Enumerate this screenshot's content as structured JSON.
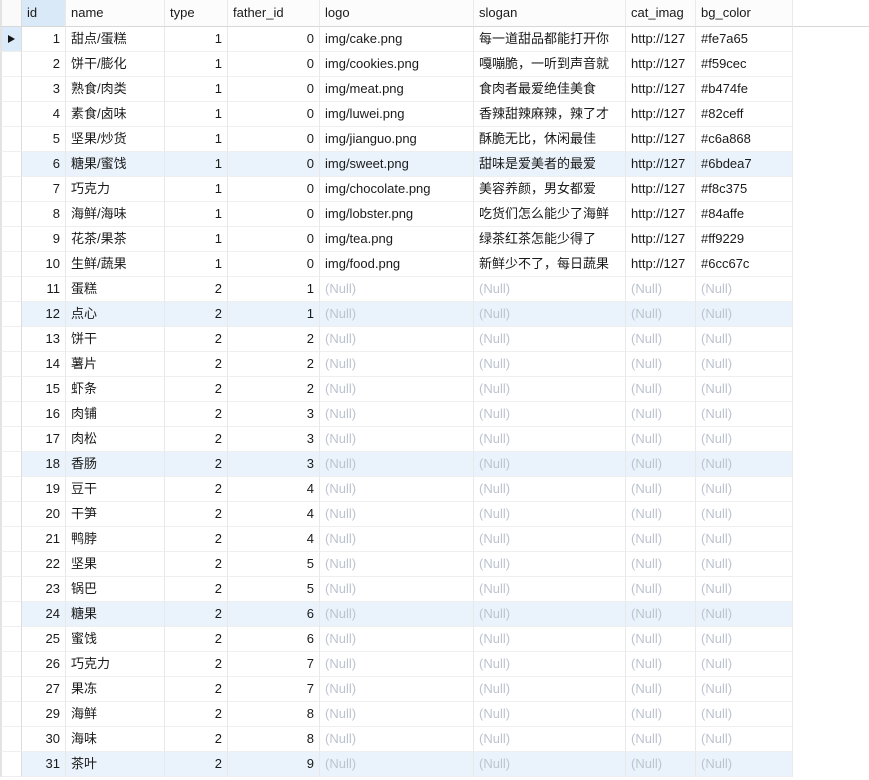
{
  "grid": {
    "columns": [
      {
        "key": "id",
        "label": "id"
      },
      {
        "key": "name",
        "label": "name"
      },
      {
        "key": "type",
        "label": "type"
      },
      {
        "key": "father_id",
        "label": "father_id"
      },
      {
        "key": "logo",
        "label": "logo"
      },
      {
        "key": "slogan",
        "label": "slogan"
      },
      {
        "key": "cat_imag",
        "label": "cat_imag"
      },
      {
        "key": "bg_color",
        "label": "bg_color"
      }
    ],
    "selected_column": "id",
    "current_row_id": "1",
    "null_text": "(Null)",
    "rows": [
      {
        "id": "1",
        "name": "甜点/蛋糕",
        "type": "1",
        "father_id": "0",
        "logo": "img/cake.png",
        "slogan": "每一道甜品都能打开你",
        "cat_imag": "http://127",
        "bg_color": "#fe7a65"
      },
      {
        "id": "2",
        "name": "饼干/膨化",
        "type": "1",
        "father_id": "0",
        "logo": "img/cookies.png",
        "slogan": "嘎嘣脆，一听到声音就",
        "cat_imag": "http://127",
        "bg_color": "#f59cec"
      },
      {
        "id": "3",
        "name": "熟食/肉类",
        "type": "1",
        "father_id": "0",
        "logo": "img/meat.png",
        "slogan": "食肉者最爱绝佳美食",
        "cat_imag": "http://127",
        "bg_color": "#b474fe"
      },
      {
        "id": "4",
        "name": "素食/卤味",
        "type": "1",
        "father_id": "0",
        "logo": "img/luwei.png",
        "slogan": "香辣甜辣麻辣，辣了才",
        "cat_imag": "http://127",
        "bg_color": "#82ceff"
      },
      {
        "id": "5",
        "name": "坚果/炒货",
        "type": "1",
        "father_id": "0",
        "logo": "img/jianguo.png",
        "slogan": "酥脆无比，休闲最佳",
        "cat_imag": "http://127",
        "bg_color": "#c6a868"
      },
      {
        "id": "6",
        "name": "糖果/蜜饯",
        "type": "1",
        "father_id": "0",
        "logo": "img/sweet.png",
        "slogan": "甜味是爱美者的最爱",
        "cat_imag": "http://127",
        "bg_color": "#6bdea7"
      },
      {
        "id": "7",
        "name": "巧克力",
        "type": "1",
        "father_id": "0",
        "logo": "img/chocolate.png",
        "slogan": "美容养颜，男女都爱",
        "cat_imag": "http://127",
        "bg_color": "#f8c375"
      },
      {
        "id": "8",
        "name": "海鲜/海味",
        "type": "1",
        "father_id": "0",
        "logo": "img/lobster.png",
        "slogan": "吃货们怎么能少了海鲜",
        "cat_imag": "http://127",
        "bg_color": "#84affe"
      },
      {
        "id": "9",
        "name": "花茶/果茶",
        "type": "1",
        "father_id": "0",
        "logo": "img/tea.png",
        "slogan": "绿茶红茶怎能少得了",
        "cat_imag": "http://127",
        "bg_color": "#ff9229"
      },
      {
        "id": "10",
        "name": "生鲜/蔬果",
        "type": "1",
        "father_id": "0",
        "logo": "img/food.png",
        "slogan": "新鲜少不了，每日蔬果",
        "cat_imag": "http://127",
        "bg_color": "#6cc67c"
      },
      {
        "id": "11",
        "name": "蛋糕",
        "type": "2",
        "father_id": "1",
        "logo": null,
        "slogan": null,
        "cat_imag": null,
        "bg_color": null
      },
      {
        "id": "12",
        "name": "点心",
        "type": "2",
        "father_id": "1",
        "logo": null,
        "slogan": null,
        "cat_imag": null,
        "bg_color": null
      },
      {
        "id": "13",
        "name": "饼干",
        "type": "2",
        "father_id": "2",
        "logo": null,
        "slogan": null,
        "cat_imag": null,
        "bg_color": null
      },
      {
        "id": "14",
        "name": "薯片",
        "type": "2",
        "father_id": "2",
        "logo": null,
        "slogan": null,
        "cat_imag": null,
        "bg_color": null
      },
      {
        "id": "15",
        "name": "虾条",
        "type": "2",
        "father_id": "2",
        "logo": null,
        "slogan": null,
        "cat_imag": null,
        "bg_color": null
      },
      {
        "id": "16",
        "name": "肉铺",
        "type": "2",
        "father_id": "3",
        "logo": null,
        "slogan": null,
        "cat_imag": null,
        "bg_color": null
      },
      {
        "id": "17",
        "name": "肉松",
        "type": "2",
        "father_id": "3",
        "logo": null,
        "slogan": null,
        "cat_imag": null,
        "bg_color": null
      },
      {
        "id": "18",
        "name": "香肠",
        "type": "2",
        "father_id": "3",
        "logo": null,
        "slogan": null,
        "cat_imag": null,
        "bg_color": null
      },
      {
        "id": "19",
        "name": "豆干",
        "type": "2",
        "father_id": "4",
        "logo": null,
        "slogan": null,
        "cat_imag": null,
        "bg_color": null
      },
      {
        "id": "20",
        "name": "干笋",
        "type": "2",
        "father_id": "4",
        "logo": null,
        "slogan": null,
        "cat_imag": null,
        "bg_color": null
      },
      {
        "id": "21",
        "name": "鸭脖",
        "type": "2",
        "father_id": "4",
        "logo": null,
        "slogan": null,
        "cat_imag": null,
        "bg_color": null
      },
      {
        "id": "22",
        "name": "坚果",
        "type": "2",
        "father_id": "5",
        "logo": null,
        "slogan": null,
        "cat_imag": null,
        "bg_color": null
      },
      {
        "id": "23",
        "name": "锅巴",
        "type": "2",
        "father_id": "5",
        "logo": null,
        "slogan": null,
        "cat_imag": null,
        "bg_color": null
      },
      {
        "id": "24",
        "name": "糖果",
        "type": "2",
        "father_id": "6",
        "logo": null,
        "slogan": null,
        "cat_imag": null,
        "bg_color": null
      },
      {
        "id": "25",
        "name": "蜜饯",
        "type": "2",
        "father_id": "6",
        "logo": null,
        "slogan": null,
        "cat_imag": null,
        "bg_color": null
      },
      {
        "id": "26",
        "name": "巧克力",
        "type": "2",
        "father_id": "7",
        "logo": null,
        "slogan": null,
        "cat_imag": null,
        "bg_color": null
      },
      {
        "id": "27",
        "name": "果冻",
        "type": "2",
        "father_id": "7",
        "logo": null,
        "slogan": null,
        "cat_imag": null,
        "bg_color": null
      },
      {
        "id": "29",
        "name": "海鲜",
        "type": "2",
        "father_id": "8",
        "logo": null,
        "slogan": null,
        "cat_imag": null,
        "bg_color": null
      },
      {
        "id": "30",
        "name": "海味",
        "type": "2",
        "father_id": "8",
        "logo": null,
        "slogan": null,
        "cat_imag": null,
        "bg_color": null
      },
      {
        "id": "31",
        "name": "茶叶",
        "type": "2",
        "father_id": "9",
        "logo": null,
        "slogan": null,
        "cat_imag": null,
        "bg_color": null
      }
    ]
  },
  "colors": {
    "stripe_blue": "#eaf3fb",
    "header_selected": "#d9e9f8",
    "gutter_selected": "#dcebf9",
    "null_text_color": "#bcc3cf",
    "row_indicator": "#151515"
  }
}
